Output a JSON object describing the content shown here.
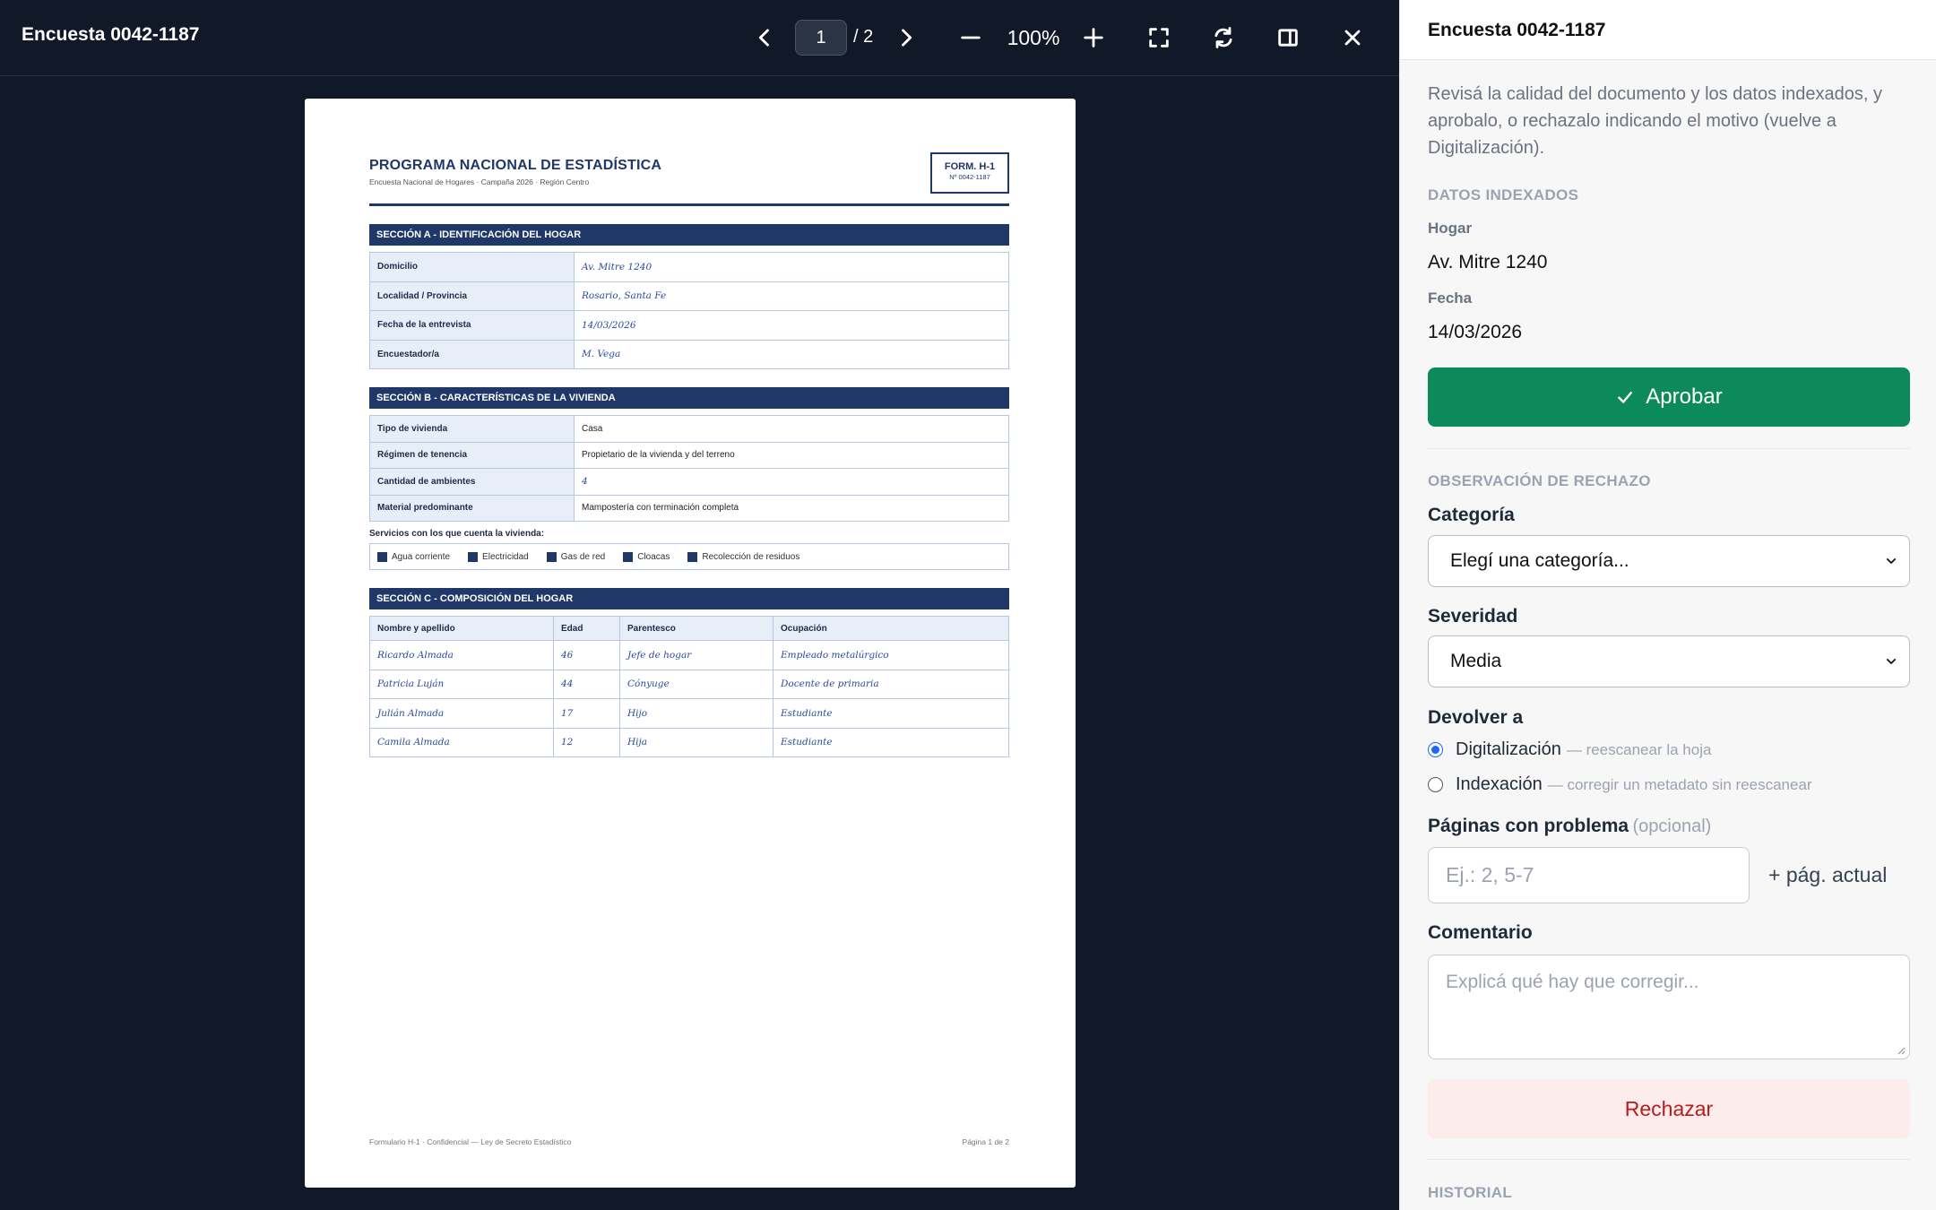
{
  "viewer": {
    "title": "Encuesta 0042-1187",
    "current_page": "1",
    "total_pages": "/ 2",
    "zoom": "100%",
    "icons": [
      "chevron-left-icon",
      "chevron-right-icon",
      "zoom-out-icon",
      "zoom-in-icon",
      "fullscreen-icon",
      "rotate-icon",
      "side-panel-icon",
      "close-icon"
    ]
  },
  "document": {
    "program_title": "PROGRAMA NACIONAL DE ESTADÍSTICA",
    "program_subtitle": "Encuesta Nacional de Hogares · Campaña 2026 · Región Centro",
    "form_code": "FORM. H-1",
    "form_number": "Nº 0042-1187",
    "section_a": {
      "title": "SECCIÓN A - IDENTIFICACIÓN DEL HOGAR",
      "rows": [
        {
          "label": "Domicilio",
          "value": "Av. Mitre 1240"
        },
        {
          "label": "Localidad / Provincia",
          "value": "Rosario, Santa Fe"
        },
        {
          "label": "Fecha de la entrevista",
          "value": "14/03/2026"
        },
        {
          "label": "Encuestador/a",
          "value": "M. Vega"
        }
      ]
    },
    "section_b": {
      "title": "SECCIÓN B - CARACTERÍSTICAS DE LA VIVIENDA",
      "rows": [
        {
          "label": "Tipo de vivienda",
          "value": "Casa"
        },
        {
          "label": "Régimen de tenencia",
          "value": "Propietario de la vivienda y del terreno"
        },
        {
          "label": "Cantidad de ambientes",
          "value": "4"
        },
        {
          "label": "Material predominante",
          "value": "Mampostería con terminación completa"
        }
      ],
      "services_label": "Servicios con los que cuenta la vivienda:",
      "services": [
        "Agua corriente",
        "Electricidad",
        "Gas de red",
        "Cloacas",
        "Recolección de residuos"
      ]
    },
    "section_c": {
      "title": "SECCIÓN C - COMPOSICIÓN DEL HOGAR",
      "headers": [
        "Nombre y apellido",
        "Edad",
        "Parentesco",
        "Ocupación"
      ],
      "rows": [
        [
          "Ricardo Almada",
          "46",
          "Jefe de hogar",
          "Empleado metalúrgico"
        ],
        [
          "Patricia Luján",
          "44",
          "Cónyuge",
          "Docente de primaria"
        ],
        [
          "Julián Almada",
          "17",
          "Hijo",
          "Estudiante"
        ],
        [
          "Camila Almada",
          "12",
          "Hija",
          "Estudiante"
        ]
      ]
    },
    "footer_left": "Formulario H-1 · Confidencial — Ley de Secreto Estadístico",
    "footer_right": "Página 1 de 2"
  },
  "panel": {
    "title": "Encuesta 0042-1187",
    "intro": "Revisá la calidad del documento y los datos indexados, y aprobalo, o rechazalo indicando el motivo (vuelve a Digitalización).",
    "indexed_label": "DATOS INDEXADOS",
    "hogar_label": "Hogar",
    "hogar_value": "Av. Mitre 1240",
    "fecha_label": "Fecha",
    "fecha_value": "14/03/2026",
    "approve_label": "Aprobar",
    "reject_section_label": "OBSERVACIÓN DE RECHAZO",
    "category_label": "Categoría",
    "category_value": "Elegí una categoría...",
    "severity_label": "Severidad",
    "severity_value": "Media",
    "return_label": "Devolver a",
    "return_options": [
      {
        "label": "Digitalización",
        "hint": "— reescanear la hoja",
        "selected": true
      },
      {
        "label": "Indexación",
        "hint": "— corregir un metadato sin reescanear",
        "selected": false
      }
    ],
    "pages_label": "Páginas con problema",
    "pages_optional": "(opcional)",
    "pages_placeholder": "Ej.: 2, 5-7",
    "add_page_label": "+ pág. actual",
    "comment_label": "Comentario",
    "comment_placeholder": "Explicá qué hay que corregir...",
    "reject_label": "Rechazar",
    "history_label": "HISTORIAL"
  }
}
